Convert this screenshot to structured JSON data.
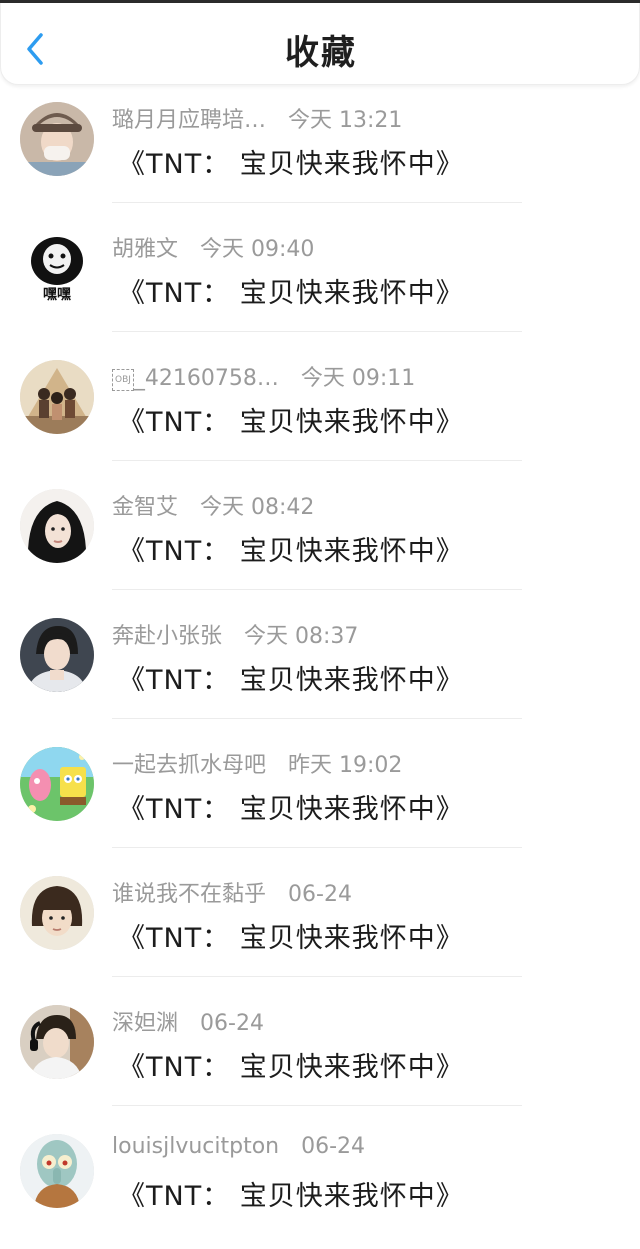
{
  "header": {
    "title": "收藏",
    "back_icon": "chevron-left-icon",
    "accent": "#2d9cf0"
  },
  "items": [
    {
      "name": "璐月月应聘培…",
      "time": "今天 13:21",
      "message": "《TNT： 宝贝快来我怀中》",
      "avatar": "girl-cap-photo"
    },
    {
      "name": "胡雅文",
      "time": "今天 09:40",
      "message": "《TNT： 宝贝快来我怀中》",
      "avatar": "meme-face",
      "avatar_text": "嘿嘿"
    },
    {
      "name": "_42160758…",
      "name_prefix": "OBJ",
      "time": "今天 09:11",
      "message": "《TNT： 宝贝快来我怀中》",
      "avatar": "group-photo"
    },
    {
      "name": "金智艾",
      "time": "今天 08:42",
      "message": "《TNT： 宝贝快来我怀中》",
      "avatar": "woman-dark-hair"
    },
    {
      "name": "奔赴小张张",
      "time": "今天 08:37",
      "message": "《TNT： 宝贝快来我怀中》",
      "avatar": "young-man"
    },
    {
      "name": "一起去抓水母吧",
      "time": "昨天 19:02",
      "message": "《TNT： 宝贝快来我怀中》",
      "avatar": "cartoon-sponge"
    },
    {
      "name": "谁说我不在黏乎",
      "time": "06-24",
      "message": "《TNT： 宝贝快来我怀中》",
      "avatar": "boy-bowl-cut"
    },
    {
      "name": "深妲渊",
      "time": "06-24",
      "message": "《TNT： 宝贝快来我怀中》",
      "avatar": "boy-headphones"
    },
    {
      "name": "louisjlvucitpton",
      "time": "06-24",
      "message": "《TNT： 宝贝快来我怀中》",
      "avatar": "cartoon-squid"
    }
  ]
}
